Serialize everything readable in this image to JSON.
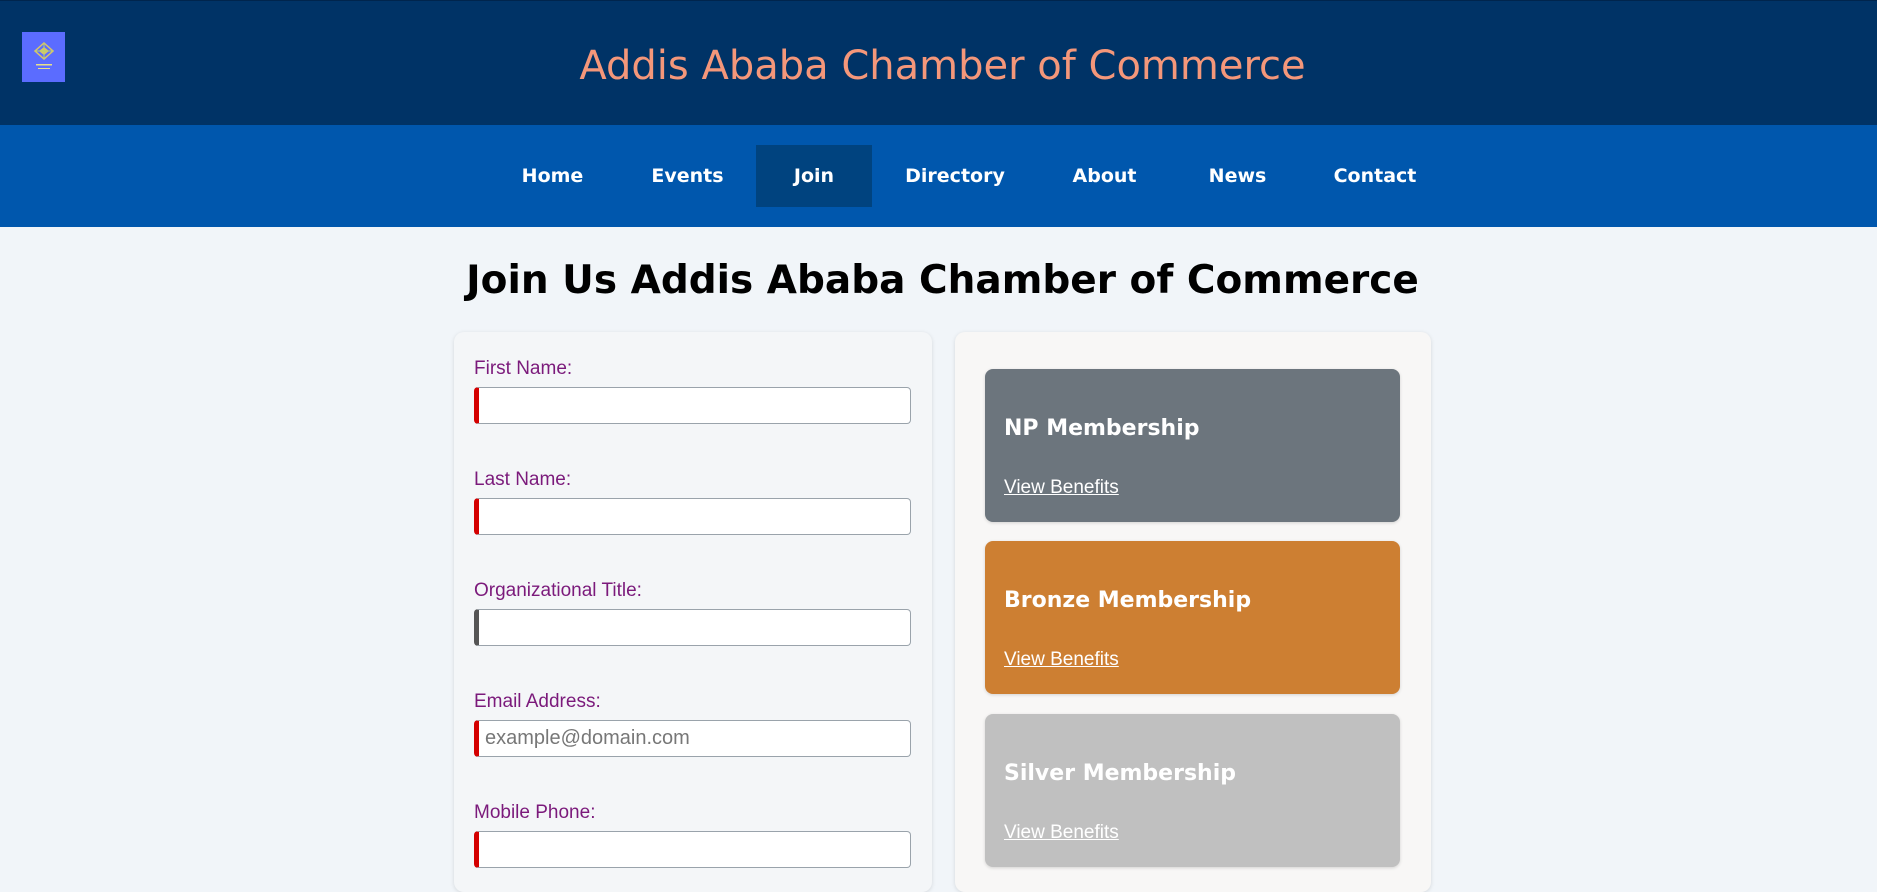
{
  "header": {
    "title": "Addis Ababa Chamber of Commerce",
    "logo_icon": "chamber-logo-icon"
  },
  "nav": {
    "items": [
      {
        "label": "Home"
      },
      {
        "label": "Events"
      },
      {
        "label": "Join",
        "active": true
      },
      {
        "label": "Directory"
      },
      {
        "label": "About"
      },
      {
        "label": "News"
      },
      {
        "label": "Contact"
      }
    ]
  },
  "page": {
    "heading": "Join Us Addis Ababa Chamber of Commerce"
  },
  "form": {
    "fields": [
      {
        "label": "First Name:",
        "value": "",
        "placeholder": "",
        "required": true
      },
      {
        "label": "Last Name:",
        "value": "",
        "placeholder": "",
        "required": true
      },
      {
        "label": "Organizational Title:",
        "value": "",
        "placeholder": "",
        "required": false
      },
      {
        "label": "Email Address:",
        "value": "",
        "placeholder": "example@domain.com",
        "required": true
      },
      {
        "label": "Mobile Phone:",
        "value": "",
        "placeholder": "",
        "required": true
      }
    ]
  },
  "memberships": [
    {
      "name": "NP Membership",
      "link": "View Benefits",
      "color": "#6c757d"
    },
    {
      "name": "Bronze Membership",
      "link": "View Benefits",
      "color": "#cd7f32"
    },
    {
      "name": "Silver Membership",
      "link": "View Benefits",
      "color": "#c0c0c0"
    }
  ],
  "colors": {
    "header_bg": "#003366",
    "nav_bg": "#0057ad",
    "nav_active_bg": "#00437f",
    "title_color": "#f4977a",
    "label_color": "#7b1a7b",
    "required_marker": "#d40000",
    "optional_marker": "#555555"
  }
}
